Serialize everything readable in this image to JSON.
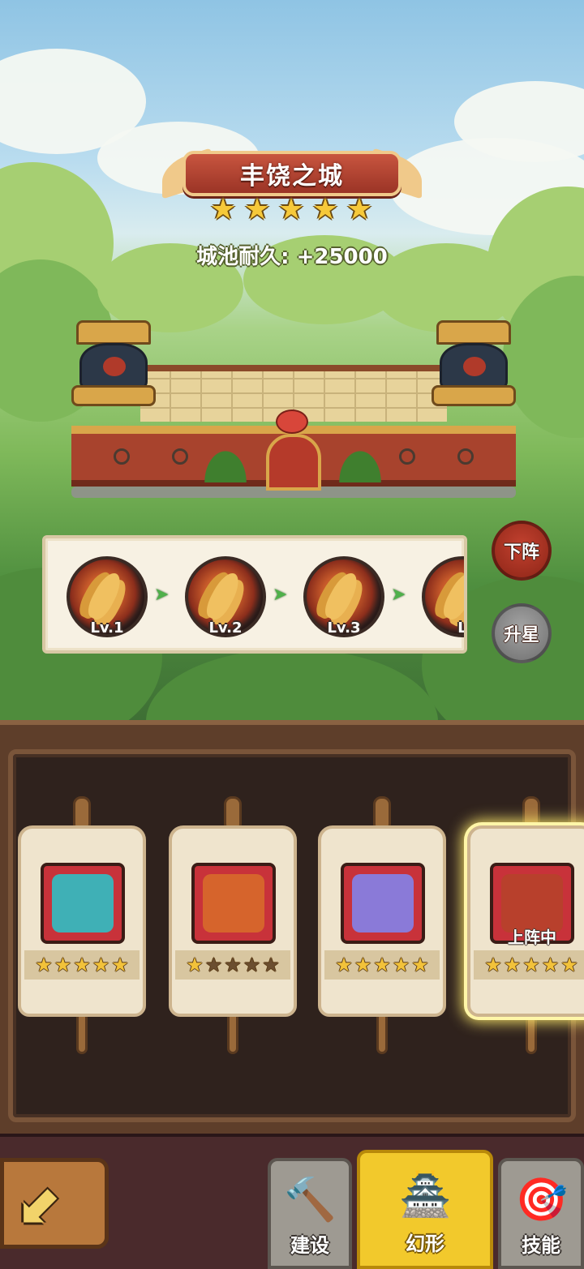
{
  "city": {
    "name": "丰饶之城",
    "stars": 5,
    "durability_text": "城池耐久: +25000"
  },
  "upgrade_levels": [
    {
      "label": "Lv.1"
    },
    {
      "label": "Lv.2"
    },
    {
      "label": "Lv.3"
    },
    {
      "label": "L"
    }
  ],
  "side_buttons": {
    "unequip_label": "下阵",
    "star_up_label": "升星"
  },
  "skins": [
    {
      "name": "dragon-boat-city-icon",
      "stars": 5,
      "art_color": "#3fb0b6",
      "selected": false
    },
    {
      "name": "stone-golem-city-icon",
      "stars": 1,
      "art_color": "#d6642c",
      "selected": false
    },
    {
      "name": "purple-temple-city-icon",
      "stars": 5,
      "art_color": "#8a7ad8",
      "selected": false
    },
    {
      "name": "harvest-city-icon",
      "stars": 5,
      "art_color": "#b8402c",
      "selected": true,
      "tag": "上阵中"
    }
  ],
  "bottom_nav": {
    "back_icon": "back-arrow-icon",
    "tabs": [
      {
        "label": "建设",
        "icon": "hammer-icon"
      },
      {
        "label": "幻形",
        "icon": "castle-icon",
        "active": true
      },
      {
        "label": "技能",
        "icon": "target-icon"
      }
    ]
  },
  "colors": {
    "accent_active_tab": "#f2c92c",
    "unequip_button": "#b03a2a",
    "star_button": "#8a8a8a"
  }
}
